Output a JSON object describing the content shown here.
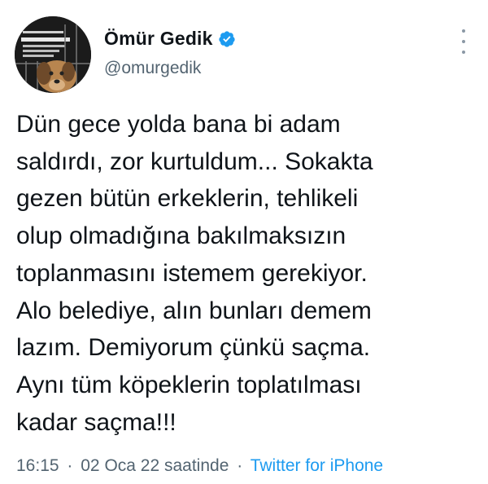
{
  "author": {
    "display_name": "Ömür Gedik",
    "handle": "@omurgedik",
    "verified": true,
    "verified_color": "#1d9bf0",
    "avatar_icon": "dog-photo-avatar"
  },
  "tweet": {
    "lines": [
      "Dün gece yolda bana bi adam",
      "saldırdı, zor kurtuldum... Sokakta",
      "gezen bütün erkeklerin, tehlikeli",
      "olup olmadığına bakılmaksızın",
      "toplanmasını istemem gerekiyor.",
      "Alo belediye, alın bunları demem",
      "lazım. Demiyorum çünkü saçma.",
      "Aynı tüm köpeklerin toplatılması",
      "kadar saçma!!!"
    ]
  },
  "meta": {
    "time": "16:15",
    "date": "02 Oca 22 saatinde",
    "separator": "·",
    "source": "Twitter for iPhone",
    "link_color": "#1d9bf0"
  },
  "actions": {
    "more_icon": "more-options-icon"
  }
}
